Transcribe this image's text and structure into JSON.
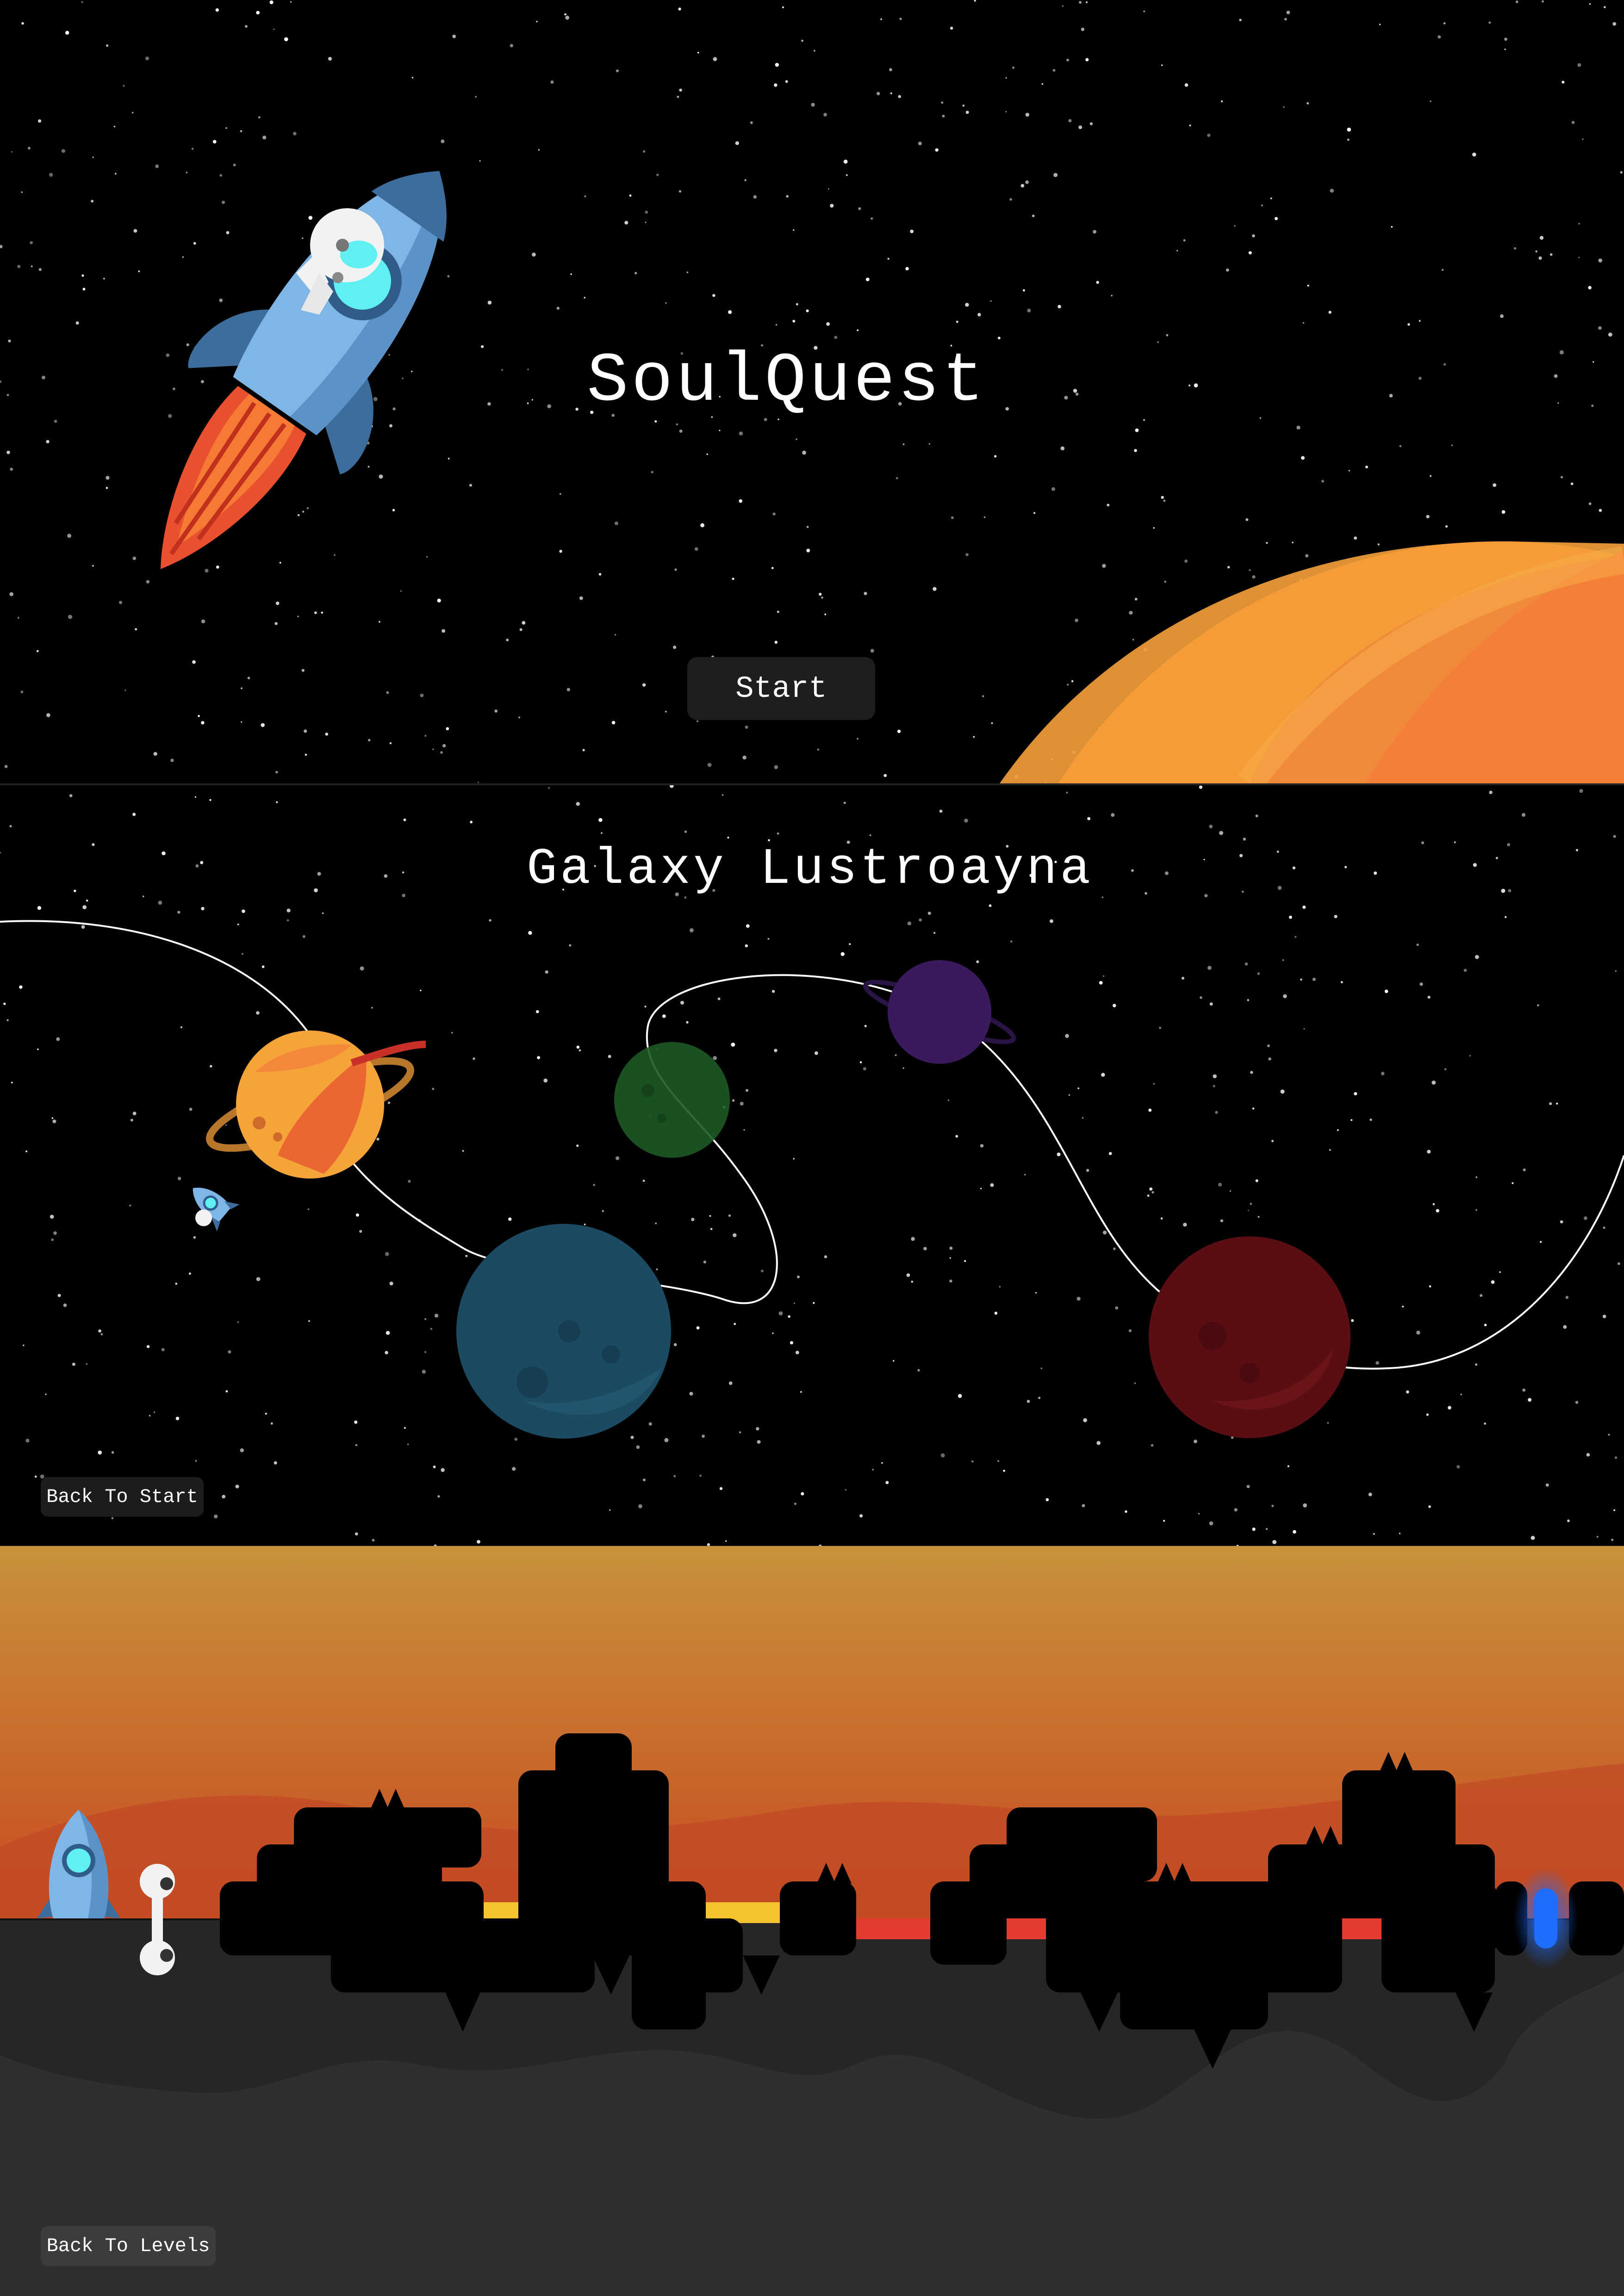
{
  "start_screen": {
    "title": "SoulQuest",
    "start_label": "Start"
  },
  "level_select": {
    "title": "Galaxy Lustroayna",
    "back_label": "Back To Start",
    "planets": [
      {
        "name": "orange-ringed-planet",
        "state": "unlocked",
        "color": "#f27a3a"
      },
      {
        "name": "green-planet",
        "state": "locked",
        "color": "#1d5a26"
      },
      {
        "name": "purple-ringed-planet",
        "state": "locked",
        "color": "#3a1a5c"
      },
      {
        "name": "blue-planet",
        "state": "locked",
        "color": "#1b4a63"
      },
      {
        "name": "red-planet",
        "state": "locked",
        "color": "#5a0d12"
      }
    ]
  },
  "game_screen": {
    "back_label": "Back To Levels",
    "colors": {
      "sky_top": "#c8923a",
      "sky_bottom": "#c94a22",
      "ground": "#2f2f2f",
      "lava": "#f5c230",
      "spikes": "#e53c2f",
      "portal": "#1f6cff"
    }
  },
  "colors": {
    "background": "#000000",
    "button": "#1e1e1e",
    "rocket": "#7fb6e6",
    "planet_orange": "#f5a43a"
  }
}
